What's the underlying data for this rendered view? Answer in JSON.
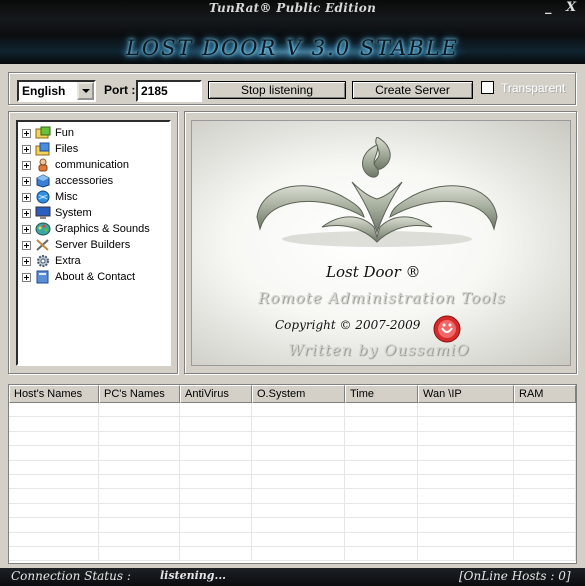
{
  "window": {
    "edition": "TunRat® Public Edition",
    "brand": "LOST DOOR V 3.0  STABLE",
    "minimize_glyph": "_",
    "close_glyph": "X"
  },
  "toolbar": {
    "language": "English",
    "port_label": "Port :",
    "port_value": "2185",
    "stop_label": "Stop listening",
    "create_label": "Create Server",
    "transparent_label": "Transparent",
    "transparent_checked": false
  },
  "tree": {
    "items": [
      {
        "label": "Fun",
        "icon": "folder-game-icon"
      },
      {
        "label": "Files",
        "icon": "folder-files-icon"
      },
      {
        "label": "communication",
        "icon": "person-icon"
      },
      {
        "label": "accessories",
        "icon": "cube-icon"
      },
      {
        "label": "Misc",
        "icon": "globe-icon"
      },
      {
        "label": "System",
        "icon": "monitor-icon"
      },
      {
        "label": "Graphics & Sounds",
        "icon": "palette-icon"
      },
      {
        "label": "Server Builders",
        "icon": "tools-icon"
      },
      {
        "label": "Extra",
        "icon": "gear-icon"
      },
      {
        "label": "About & Contact",
        "icon": "book-icon"
      }
    ]
  },
  "logo": {
    "title": "Lost Door ®",
    "subtitle": "Romote Administration Tools",
    "copyright": "Copyright © 2007-2009",
    "author": "Written by OussamiO"
  },
  "grid": {
    "columns": [
      "Host's Names",
      "PC's Names",
      "AntiVirus",
      "O.System",
      "Time",
      "Wan \\IP",
      "RAM"
    ],
    "rows": []
  },
  "status": {
    "label": "Connection Status :",
    "value": "listening...",
    "hosts": "[OnLine Hosts : 0]"
  },
  "colors": {
    "chrome_dark": "#0b0d0f",
    "panel": "#d4d0c8",
    "glow": "#4fb6e6"
  }
}
